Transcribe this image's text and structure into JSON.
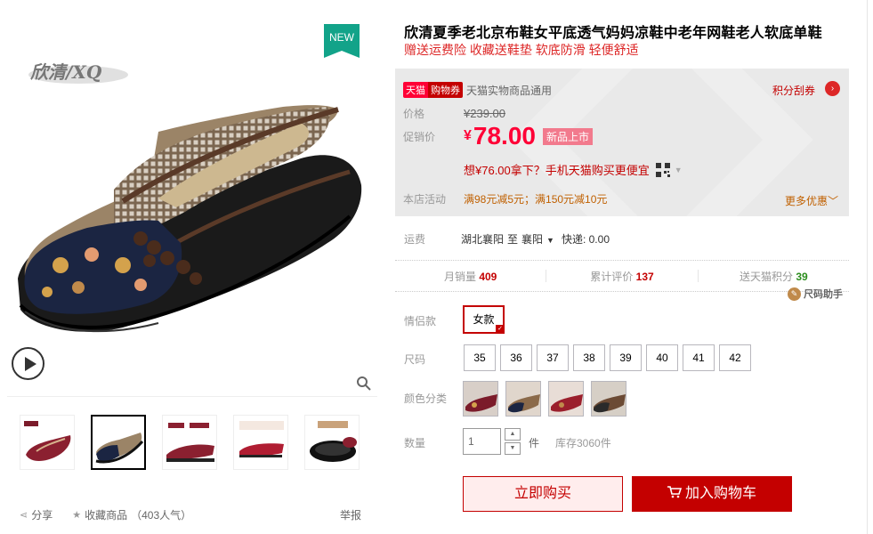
{
  "gallery": {
    "new_badge": "NEW",
    "brand_logo": "欣清/XQ",
    "thumbs": [
      "thumb-1",
      "thumb-2",
      "thumb-3",
      "thumb-4",
      "thumb-5"
    ],
    "selected_thumb": 2,
    "share_label": "分享",
    "favorite_label": "收藏商品",
    "favorite_count": "（403人气）",
    "report_label": "举报"
  },
  "product": {
    "title": "欣清夏季老北京布鞋女平底透气妈妈凉鞋中老年网鞋老人软底单鞋",
    "subtitle": "赠送运费险 收藏送鞋垫 软底防滑 轻便舒适"
  },
  "price_box": {
    "tag_tmall": "天猫",
    "tag_coupon": "购物券",
    "coupon_text": "天猫实物商品通用",
    "score_link": "积分刮券",
    "original_label": "价格",
    "original_price": "¥239.00",
    "promo_label": "促销价",
    "currency": "¥",
    "promo_price": "78.00",
    "new_on_label": "新品上市",
    "mobile_tip": "想¥76.00拿下？手机天猫购买更便宜",
    "activity_label": "本店活动",
    "activity_text": "满98元减5元；满150元减10元",
    "more_offers": "更多优惠"
  },
  "shipping": {
    "label": "运费",
    "from": "湖北襄阳",
    "to_word": "至",
    "to": "襄阳",
    "method": "快递: 0.00"
  },
  "stats": {
    "monthly_sales_label": "月销量",
    "monthly_sales": "409",
    "reviews_label": "累计评价",
    "reviews": "137",
    "points_label": "送天猫积分",
    "points": "39"
  },
  "size_helper": "尺码助手",
  "options": {
    "couple_label": "情侣款",
    "couple_value": "女款",
    "size_label": "尺码",
    "sizes": [
      "35",
      "36",
      "37",
      "38",
      "39",
      "40",
      "41",
      "42"
    ],
    "color_label": "颜色分类",
    "qty_label": "数量",
    "qty_value": "1",
    "qty_unit": "件",
    "stock": "库存3060件"
  },
  "actions": {
    "buy_now": "立即购买",
    "add_cart": "加入购物车"
  },
  "colors": {
    "accent": "#c40000",
    "price": "#ff0036",
    "badge": "#12a389"
  }
}
